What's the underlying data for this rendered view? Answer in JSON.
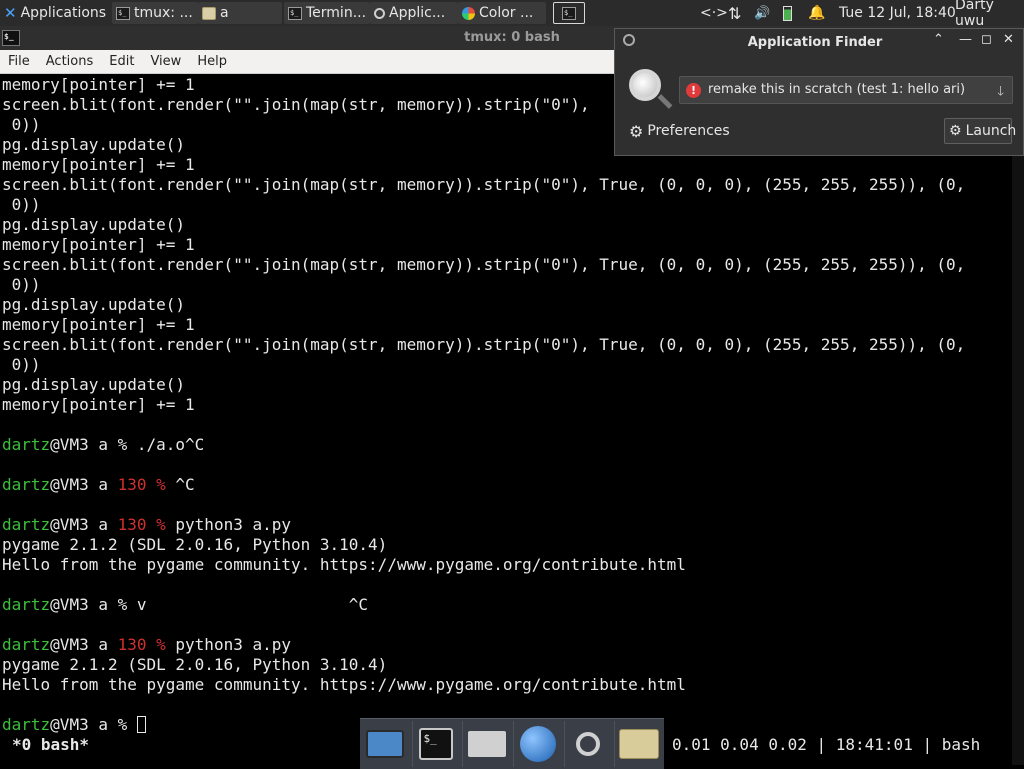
{
  "panel": {
    "applications_label": "Applications",
    "tasks": [
      {
        "label": "tmux: ...",
        "icon": "terminal-icon"
      },
      {
        "label": "a",
        "icon": "folder-icon"
      },
      {
        "label": "Termin...",
        "icon": "terminal-icon"
      },
      {
        "label": "Applic...",
        "icon": "magnifier-icon"
      },
      {
        "label": "Color ...",
        "icon": "color-icon"
      }
    ],
    "tray": {
      "network": "<·>",
      "transfer": "⇅",
      "volume": "🔊",
      "datetime": "Tue 12 Jul, 18:40",
      "user": "Darty uwu"
    }
  },
  "terminal": {
    "title": "tmux: 0 bash",
    "menu": [
      "File",
      "Actions",
      "Edit",
      "View",
      "Help"
    ],
    "colors": {
      "prompt_user": "#3bbf3b",
      "error_code": "#d03030",
      "bg": "#000000",
      "fg": "#e8e8e8"
    },
    "lines": [
      {
        "text": "memory[pointer] += 1"
      },
      {
        "text": "screen.blit(font.render(\"\".join(map(str, memory)).strip(\"0\"),"
      },
      {
        "text": " 0))"
      },
      {
        "text": "pg.display.update()"
      },
      {
        "text": "memory[pointer] += 1"
      },
      {
        "text": "screen.blit(font.render(\"\".join(map(str, memory)).strip(\"0\"), True, (0, 0, 0), (255, 255, 255)), (0,"
      },
      {
        "text": " 0))"
      },
      {
        "text": "pg.display.update()"
      },
      {
        "text": "memory[pointer] += 1"
      },
      {
        "text": "screen.blit(font.render(\"\".join(map(str, memory)).strip(\"0\"), True, (0, 0, 0), (255, 255, 255)), (0,"
      },
      {
        "text": " 0))"
      },
      {
        "text": "pg.display.update()"
      },
      {
        "text": "memory[pointer] += 1"
      },
      {
        "text": "screen.blit(font.render(\"\".join(map(str, memory)).strip(\"0\"), True, (0, 0, 0), (255, 255, 255)), (0,"
      },
      {
        "text": " 0))"
      },
      {
        "text": "pg.display.update()"
      },
      {
        "text": "memory[pointer] += 1"
      },
      {
        "text": ""
      },
      {
        "prompt": true,
        "user": "dartz",
        "host": "@VM3 a ",
        "code": "",
        "sym": "% ",
        "cmd": "./a.o^C"
      },
      {
        "text": ""
      },
      {
        "prompt": true,
        "user": "dartz",
        "host": "@VM3 a ",
        "code": "130 ",
        "sym": "% ",
        "cmd": "^C"
      },
      {
        "text": ""
      },
      {
        "prompt": true,
        "user": "dartz",
        "host": "@VM3 a ",
        "code": "130 ",
        "sym": "% ",
        "cmd": "python3 a.py"
      },
      {
        "text": "pygame 2.1.2 (SDL 2.0.16, Python 3.10.4)"
      },
      {
        "text": "Hello from the pygame community. https://www.pygame.org/contribute.html"
      },
      {
        "text": ""
      },
      {
        "prompt": true,
        "user": "dartz",
        "host": "@VM3 a ",
        "code": "",
        "sym": "% ",
        "cmd": "v                     ^C"
      },
      {
        "text": ""
      },
      {
        "prompt": true,
        "user": "dartz",
        "host": "@VM3 a ",
        "code": "130 ",
        "sym": "% ",
        "cmd": "python3 a.py"
      },
      {
        "text": "pygame 2.1.2 (SDL 2.0.16, Python 3.10.4)"
      },
      {
        "text": "Hello from the pygame community. https://www.pygame.org/contribute.html"
      },
      {
        "text": ""
      },
      {
        "prompt": true,
        "user": "dartz",
        "host": "@VM3 a ",
        "code": "",
        "sym": "% ",
        "cmd": "",
        "cursor": true
      }
    ],
    "status_left": "*0 bash*",
    "status_right": "0.01 0.04 0.02 | 18:41:01 | bash"
  },
  "dock": [
    "desktop-icon",
    "terminal-icon",
    "home-folder-icon",
    "web-browser-icon",
    "app-finder-icon",
    "folder-icon"
  ],
  "finder": {
    "title": "Application Finder",
    "query": "remake this in scratch (test 1: hello ari)",
    "preferences_label": "Preferences",
    "launch_label": "Launch"
  }
}
